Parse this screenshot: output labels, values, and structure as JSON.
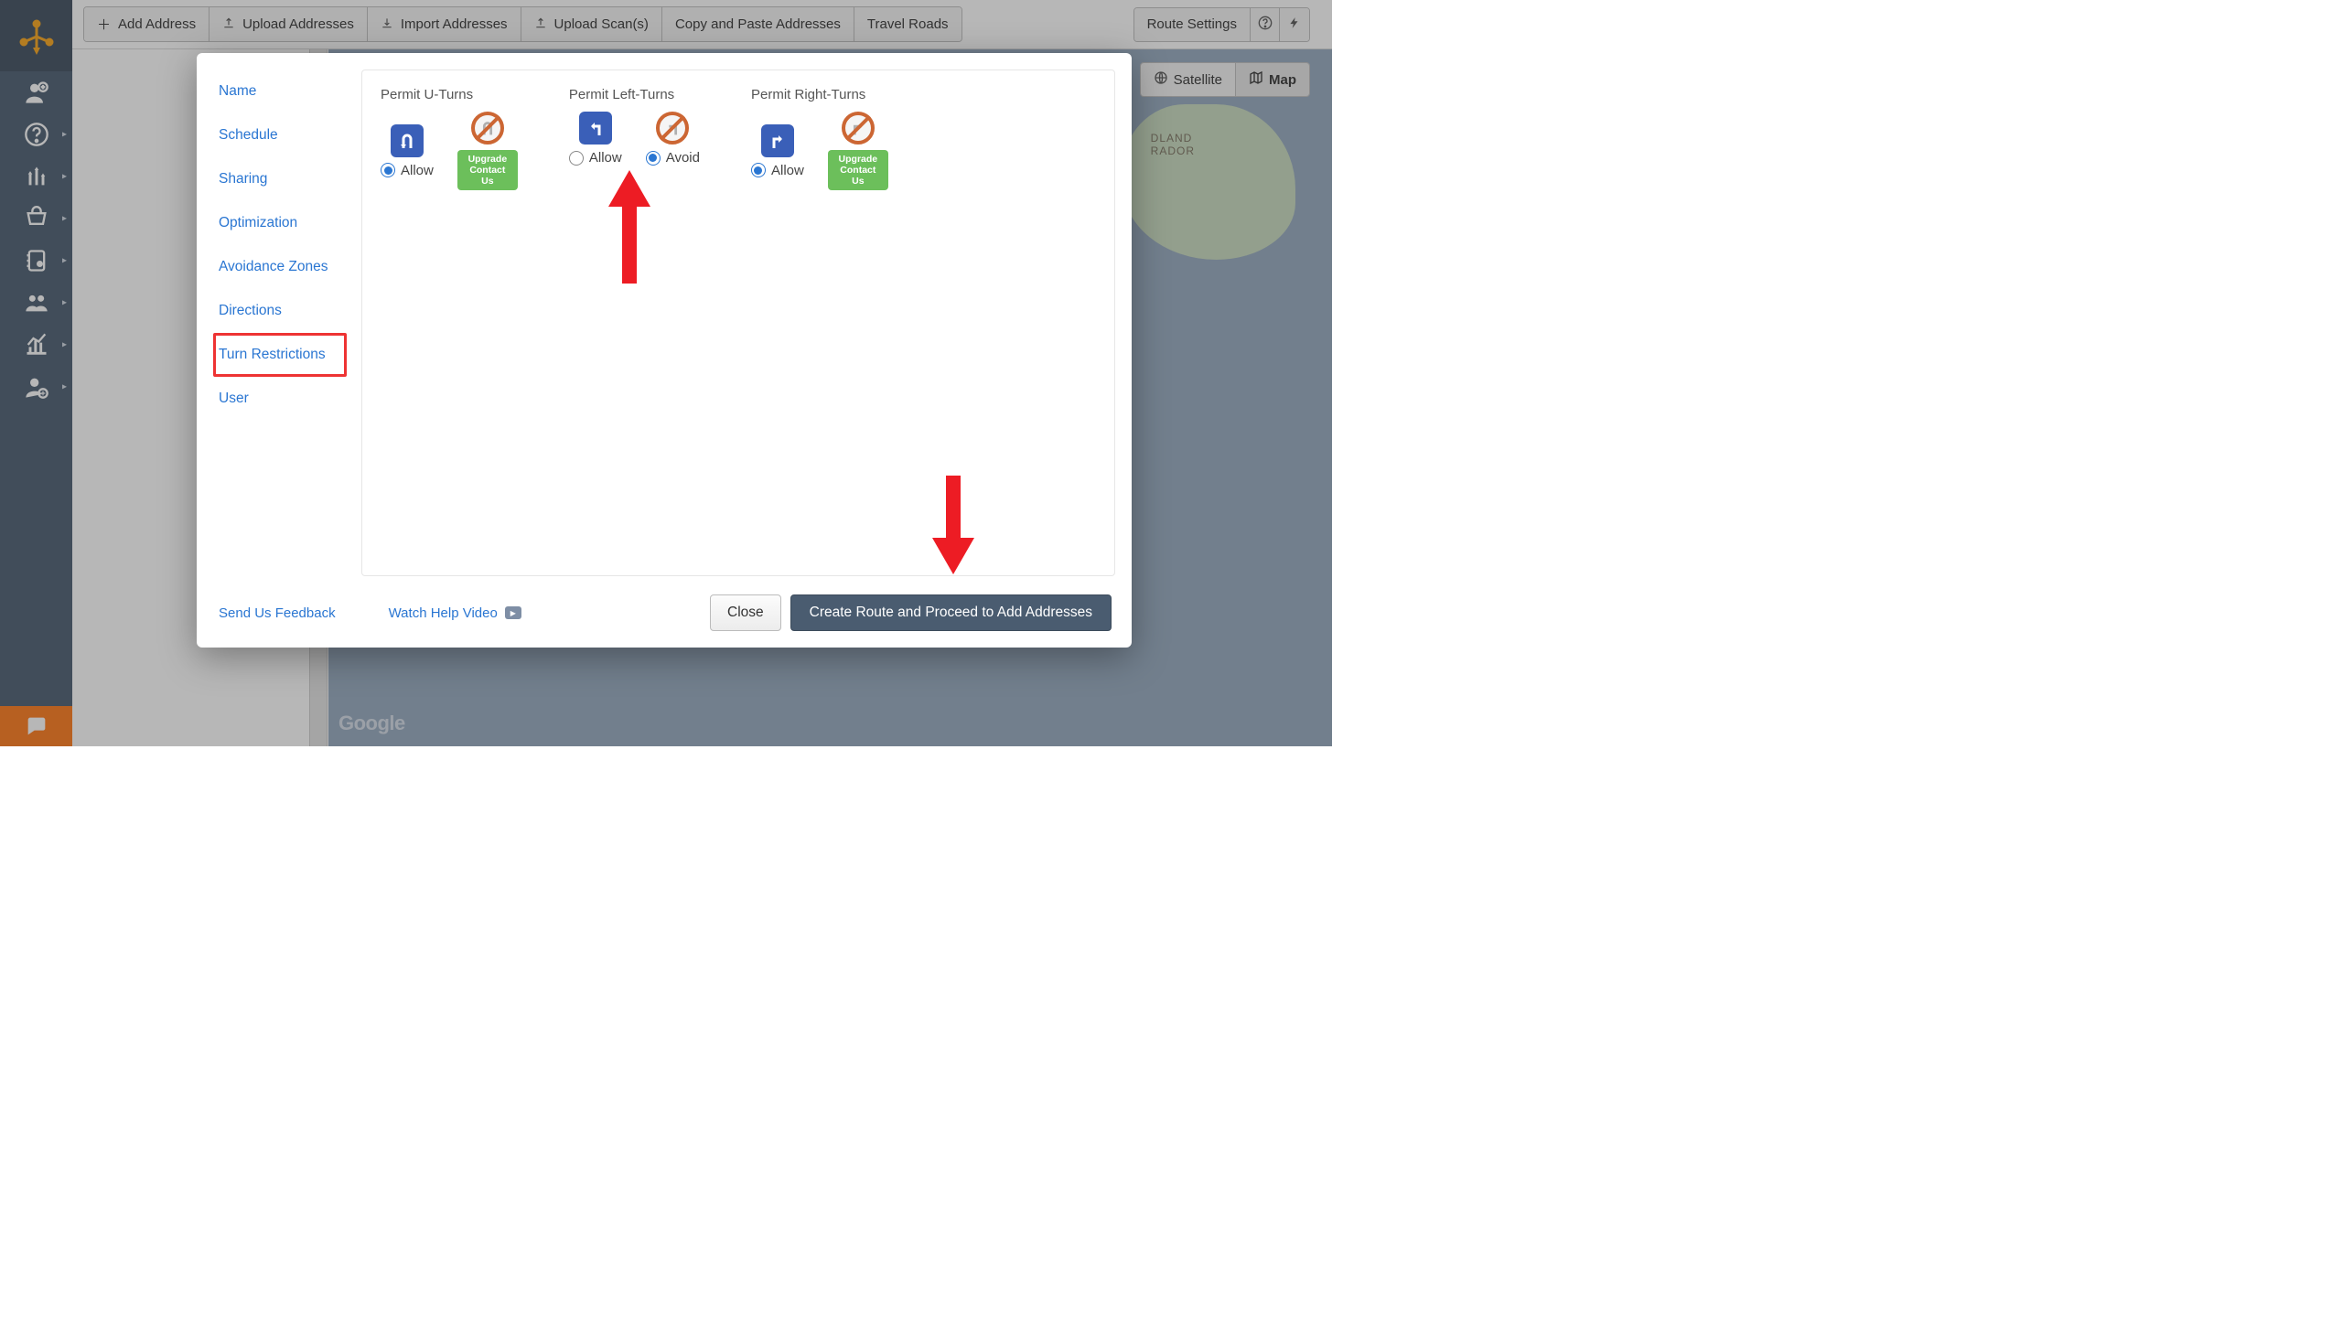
{
  "toolbar": {
    "add_address": "Add Address",
    "upload_addresses": "Upload Addresses",
    "import_addresses": "Import Addresses",
    "upload_scans": "Upload Scan(s)",
    "copy_paste": "Copy and Paste Addresses",
    "travel_roads": "Travel Roads",
    "route_settings": "Route Settings"
  },
  "map": {
    "satellite": "Satellite",
    "map": "Map",
    "watermark": "Google",
    "island_label_1": "DLAND",
    "island_label_2": "RADOR"
  },
  "modal": {
    "nav": {
      "name": "Name",
      "schedule": "Schedule",
      "sharing": "Sharing",
      "optimization": "Optimization",
      "avoidance": "Avoidance Zones",
      "directions": "Directions",
      "turn_restrictions": "Turn Restrictions",
      "user": "User"
    },
    "uturns": {
      "title": "Permit U-Turns",
      "allow": "Allow"
    },
    "leftturns": {
      "title": "Permit Left-Turns",
      "allow": "Allow",
      "avoid": "Avoid"
    },
    "rightturns": {
      "title": "Permit Right-Turns",
      "allow": "Allow"
    },
    "upgrade_line1": "Upgrade",
    "upgrade_line2": "Contact Us",
    "feedback": "Send Us Feedback",
    "watch_video": "Watch Help Video",
    "close": "Close",
    "create": "Create Route and Proceed to Add Addresses"
  }
}
